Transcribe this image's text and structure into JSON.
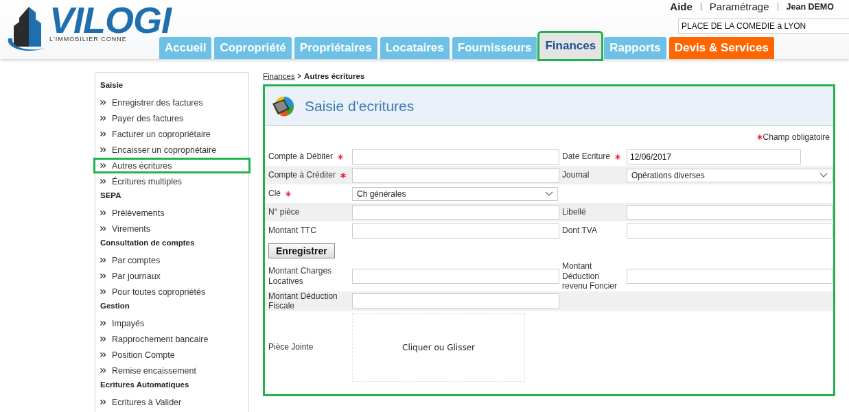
{
  "logo": {
    "name": "VILOGI",
    "tagline": "L'IMMOBILIER CONNE"
  },
  "top_links": [
    {
      "label": "Aide",
      "bold": true
    },
    {
      "label": "Paramétrage",
      "bold": false
    },
    {
      "label": "Jean DEMO",
      "bold": true
    }
  ],
  "address_field": {
    "value": "PLACE DE LA COMEDIE à LYON"
  },
  "tabs": [
    {
      "label": "Accueil",
      "kind": "standard",
      "selected": false
    },
    {
      "label": "Copropriété",
      "kind": "standard",
      "selected": false
    },
    {
      "label": "Propriétaires",
      "kind": "standard",
      "selected": false
    },
    {
      "label": "Locataires",
      "kind": "standard",
      "selected": false
    },
    {
      "label": "Fournisseurs",
      "kind": "standard",
      "selected": false
    },
    {
      "label": "Finances",
      "kind": "standard",
      "selected": true
    },
    {
      "label": "Rapports",
      "kind": "standard",
      "selected": false
    },
    {
      "label": "Devis & Services",
      "kind": "promo",
      "selected": false
    }
  ],
  "sidebar": {
    "groups": [
      {
        "title": "Saisie",
        "items": [
          {
            "label": "Enregistrer des factures",
            "selected": false
          },
          {
            "label": "Payer des factures",
            "selected": false
          },
          {
            "label": "Facturer un copropriétaire",
            "selected": false
          },
          {
            "label": "Encaisser un copropriétaire",
            "selected": false
          },
          {
            "label": "Autres écritures",
            "selected": true
          },
          {
            "label": "Écritures multiples",
            "selected": false
          }
        ]
      },
      {
        "title": "SEPA",
        "items": [
          {
            "label": "Prélèvements",
            "selected": false
          },
          {
            "label": "Virements",
            "selected": false
          }
        ]
      },
      {
        "title": "Consultation de comptes",
        "items": [
          {
            "label": "Par comptes",
            "selected": false
          },
          {
            "label": "Par journaux",
            "selected": false
          },
          {
            "label": "Pour toutes copropriétés",
            "selected": false
          }
        ]
      },
      {
        "title": "Gestion",
        "items": [
          {
            "label": "Impayés",
            "selected": false
          },
          {
            "label": "Rapprochement bancaire",
            "selected": false
          },
          {
            "label": "Position Compte",
            "selected": false
          },
          {
            "label": "Remise encaissement",
            "selected": false
          }
        ]
      },
      {
        "title": "Ecritures Automatiques",
        "items": [
          {
            "label": "Ecritures à Valider",
            "selected": false
          }
        ]
      }
    ]
  },
  "breadcrumb": {
    "link": "Finances",
    "current": "Autres écritures"
  },
  "panel": {
    "title": "Saisie d'ecritures",
    "required_note": "Champ obligatoire",
    "sections": [
      {
        "rows": [
          {
            "left": {
              "label": "Compte à Débiter",
              "required": true,
              "kind": "text"
            },
            "right": {
              "label": "Date Ecriture",
              "required": true,
              "kind": "date",
              "value": "12/06/2017"
            }
          },
          {
            "left": {
              "label": "Compte à Créditer",
              "required": true,
              "kind": "text"
            },
            "right": {
              "label": "Journal",
              "required": false,
              "kind": "select",
              "value": "Opérations diverses"
            }
          },
          {
            "left": {
              "label": "Clé",
              "required": true,
              "kind": "select",
              "value": "Ch générales"
            }
          },
          {
            "left": {
              "label": "N° pièce",
              "required": false,
              "kind": "text"
            },
            "right": {
              "label": "Libellé",
              "required": false,
              "kind": "text"
            }
          },
          {
            "left": {
              "label": "Montant TTC",
              "required": false,
              "kind": "text"
            },
            "right": {
              "label": "Dont TVA",
              "required": false,
              "kind": "text"
            }
          }
        ]
      },
      {
        "rows": [
          {
            "left": {
              "label": "Montant Charges Locatives",
              "required": false,
              "kind": "text"
            },
            "right": {
              "label": "Montant Déduction revenu Foncier",
              "required": false,
              "kind": "text"
            }
          },
          {
            "left": {
              "label": "Montant Déduction Fiscale",
              "required": false,
              "kind": "text"
            }
          }
        ]
      }
    ],
    "save_button": "Enregistrer",
    "attachment": {
      "label": "Pièce Jointe",
      "dropzone": "Cliquer ou Glisser"
    }
  }
}
